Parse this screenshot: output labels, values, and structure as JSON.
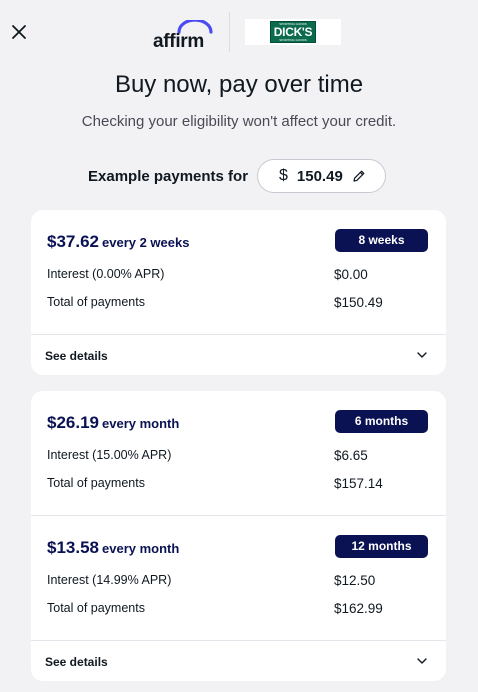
{
  "header": {
    "close_icon": "close-icon",
    "affirm_logo_text": "affirm",
    "merchant_logo_text": "DICK'S",
    "merchant_logo_top": "SPORTING GOODS",
    "merchant_logo_sub": "SPORTING GOODS",
    "colors": {
      "affirm_arc": "#4a4af4",
      "merchant_green": "#0b6b4c"
    }
  },
  "title": "Buy now, pay over time",
  "subtitle": "Checking your eligibility won't affect your credit.",
  "example": {
    "label": "Example payments for",
    "currency": "$",
    "amount": "150.49",
    "edit_icon": "pencil-icon"
  },
  "plans": [
    {
      "amount": "$37.62",
      "frequency": "every 2 weeks",
      "badge": "8 weeks",
      "interest_label": "Interest (0.00% APR)",
      "interest_value": "$0.00",
      "total_label": "Total of payments",
      "total_value": "$150.49"
    },
    {
      "amount": "$26.19",
      "frequency": "every month",
      "badge": "6 months",
      "interest_label": "Interest (15.00% APR)",
      "interest_value": "$6.65",
      "total_label": "Total of payments",
      "total_value": "$157.14"
    },
    {
      "amount": "$13.58",
      "frequency": "every month",
      "badge": "12 months",
      "interest_label": "Interest (14.99% APR)",
      "interest_value": "$12.50",
      "total_label": "Total of payments",
      "total_value": "$162.99"
    }
  ],
  "details": {
    "label": "See details",
    "chevron_icon": "chevron-down-icon"
  },
  "colors": {
    "background": "#f2f2f5",
    "accent_navy": "#0a1254",
    "card": "#ffffff"
  }
}
